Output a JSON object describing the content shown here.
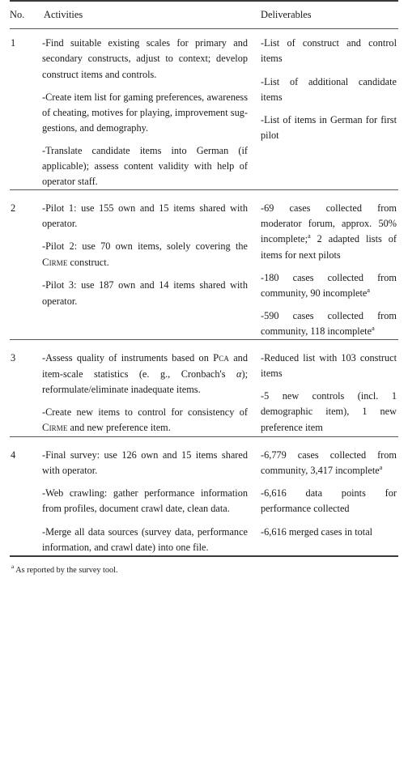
{
  "table": {
    "headers": {
      "no": "No.",
      "activities": "Activities",
      "deliverables": "Deliverables"
    },
    "rows": [
      {
        "no": "1",
        "activities": [
          "-Find suitable existing scales for pri­mary and secondary constructs, ad­just to context; develop construct items and controls.",
          "-Create item list for gaming pref­erences, awareness of cheating, mo­tives for playing, improvement sug­gestions, and demography.",
          "-Translate candidate items into Ger­man (if applicable); assess content validity with help of operator staff."
        ],
        "deliverables": [
          "-List of construct and control items",
          "-List of additional can­didate items",
          "-List of items in Ger­man for first pilot"
        ]
      },
      {
        "no": "2",
        "activities": [
          "-Pilot 1: use 155 own and 15 items shared with operator.",
          "-Pilot 2: use 70 own items, solely covering the CIRME construct.",
          "-Pilot 3: use 187 own and 14 items shared with operator."
        ],
        "deliverables": [
          "-69 cases collected from moderator forum, ap­prox. 50% incomplete;ᵃ 2 adapted lists of items for next pilots",
          "-180 cases collected from community, 90 incompleteᵃ",
          "-590 cases collected from community, 118 incompleteᵃ"
        ]
      },
      {
        "no": "3",
        "activities": [
          "-Assess quality of instruments based on PCA and item-scale statistics (e. g., Cronbach's α); reformulate/e­liminate inadequate items.",
          "-Create new items to control for con­sistency of CIRME and new prefer­ence item."
        ],
        "deliverables": [
          "-Reduced list with 103 construct items",
          "-5 new controls (incl. 1 demographic item), 1 new preference item"
        ]
      },
      {
        "no": "4",
        "activities": [
          "-Final survey: use 126 own and 15 items shared with operator.",
          "-Web crawling: gather performance information from profiles, document crawl date, clean data.",
          "-Merge all data sources (survey data, performance information, and crawl date) into one file."
        ],
        "deliverables": [
          "-6,779 cases collected from community, 3,417 incompleteᵃ",
          "-6,616 data points for performance collected",
          "-6,616 merged cases in total"
        ]
      }
    ],
    "footnote": {
      "marker": "a",
      "text": "As reported by the survey tool."
    },
    "acronyms": [
      "CIRME",
      "PCA"
    ],
    "colors": {
      "text": "#1a1a1a",
      "rule_heavy": "#3a3a3a",
      "rule_light": "#585858",
      "background": "#ffffff"
    }
  }
}
